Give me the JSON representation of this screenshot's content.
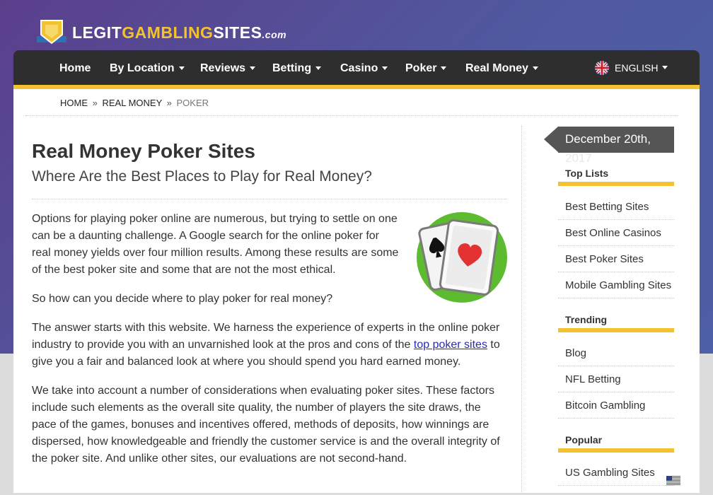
{
  "logo": {
    "part1": "LEGIT",
    "part2": "GAMBLING",
    "part3": "SITES",
    "part4": ".com"
  },
  "nav": {
    "items": [
      {
        "label": "Home",
        "dropdown": false
      },
      {
        "label": "By Location",
        "dropdown": true
      },
      {
        "label": "Reviews",
        "dropdown": true
      },
      {
        "label": "Betting",
        "dropdown": true
      },
      {
        "label": "Casino",
        "dropdown": true
      },
      {
        "label": "Poker",
        "dropdown": true
      },
      {
        "label": "Real Money",
        "dropdown": true
      }
    ],
    "language": "ENGLISH"
  },
  "breadcrumb": {
    "home": "HOME",
    "sep": "»",
    "parent": "REAL MONEY",
    "current": "POKER"
  },
  "article": {
    "title": "Real Money Poker Sites",
    "subtitle": "Where Are the Best Places to Play for Real Money?",
    "p1": "Options for playing poker online are numerous, but trying to settle on one can be a daunting challenge. A Google search for the online poker for real money yields over four million results. Among these results are some of the best poker site and some that are not the most ethical.",
    "p2": "So how can you decide where to play poker for real money?",
    "p3_before": "The answer starts with this website. We harness the experience of experts in the online poker industry to provide you with an unvarnished look at the pros and cons of the ",
    "p3_link": "top poker sites",
    "p3_after": " to give you a fair and balanced look at where you should spend you hard earned money.",
    "p4": "We take into account a number of considerations when evaluating poker sites. These factors include such elements as the overall site quality, the number of players the site draws, the pace of the games, bonuses and incentives offered, methods of deposits, how winnings are dispersed, how knowledgeable and friendly the customer service is and the overall integrity of the poker site. And unlike other sites, our evaluations are not second-hand."
  },
  "sidebar": {
    "date_line1": "December 20th,",
    "date_line2": "2017",
    "sections": [
      {
        "heading": "Top Lists",
        "links": [
          "Best Betting Sites",
          "Best Online Casinos",
          "Best Poker Sites",
          "Mobile Gambling Sites"
        ]
      },
      {
        "heading": "Trending",
        "links": [
          "Blog",
          "NFL Betting",
          "Bitcoin Gambling"
        ]
      },
      {
        "heading": "Popular",
        "links": [
          "US Gambling Sites"
        ]
      }
    ]
  },
  "colors": {
    "accent": "#f2c230",
    "nav_bg": "#2e2e2e",
    "link": "#2a2ab8",
    "bg_purple": "#5b3f8c"
  },
  "icons": [
    "logo-shield-icon",
    "uk-flag-icon",
    "playing-cards-icon",
    "us-flag-icon"
  ]
}
